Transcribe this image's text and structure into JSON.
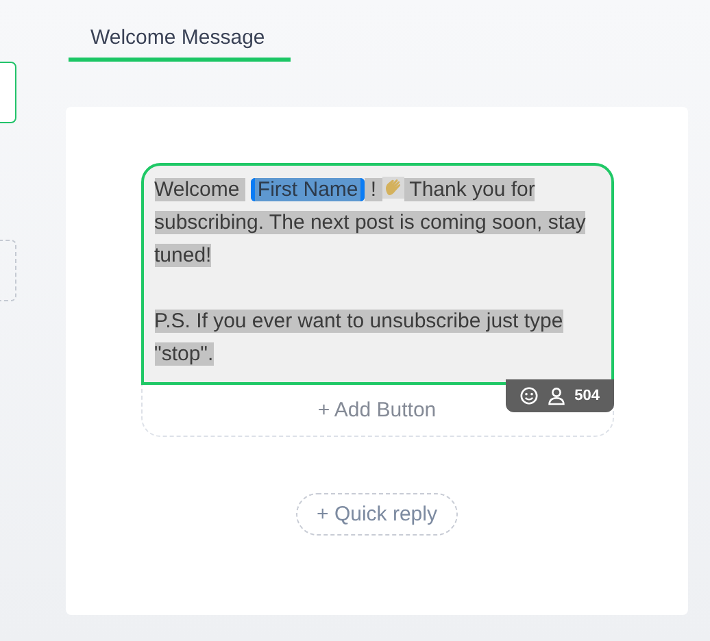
{
  "tab": {
    "label": "Welcome Message",
    "selected": true
  },
  "message": {
    "selected": true,
    "paragraphs": [
      {
        "parts": [
          {
            "kind": "text",
            "text": "Welcome "
          },
          {
            "kind": "variable",
            "text": "First Name"
          },
          {
            "kind": "text",
            "text": " ! "
          },
          {
            "kind": "emoji"
          },
          {
            "kind": "text",
            "text": " Thank you for subscribing. The next post is coming soon, stay tuned!"
          }
        ]
      },
      {
        "parts": [
          {
            "kind": "text",
            "text": "P.S. If you ever want to unsubscribe just type \"stop\"."
          }
        ]
      }
    ]
  },
  "subscriber_count": "504",
  "add_button": "+ Add Button",
  "quick_reply": "+ Quick reply"
}
